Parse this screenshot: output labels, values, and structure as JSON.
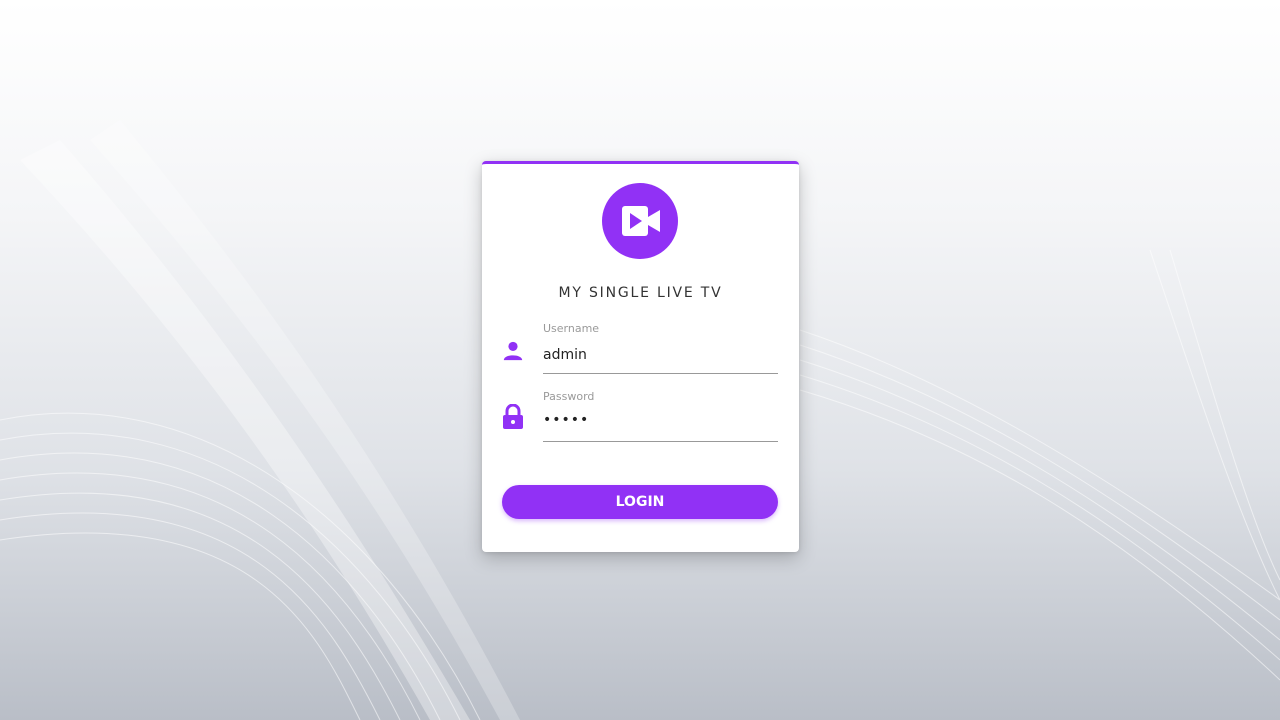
{
  "brand": {
    "accent_color": "#9131f5",
    "logo_icon": "video-camera-icon"
  },
  "app": {
    "title": "MY SINGLE LIVE TV"
  },
  "form": {
    "username": {
      "label": "Username",
      "value": "admin",
      "icon": "user-icon"
    },
    "password": {
      "label": "Password",
      "value": "•••••",
      "icon": "lock-icon"
    },
    "submit_label": "LOGIN"
  }
}
